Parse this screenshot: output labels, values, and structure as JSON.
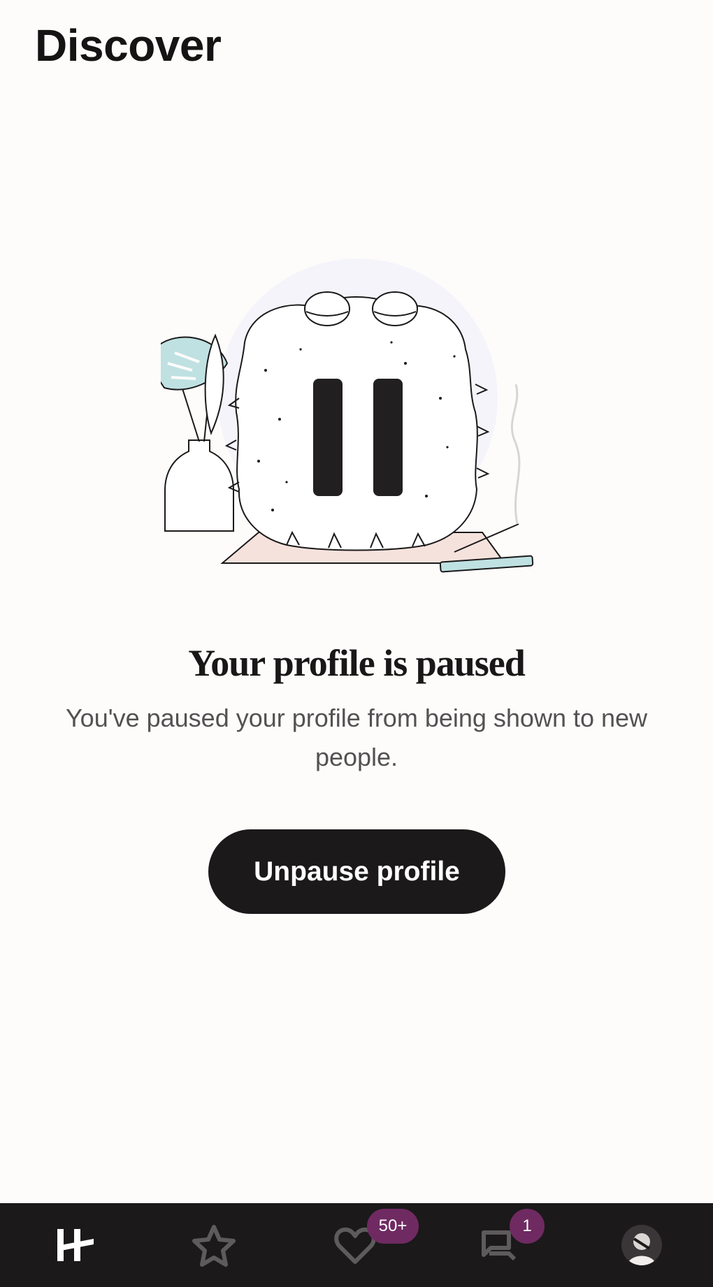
{
  "header": {
    "title": "Discover"
  },
  "paused": {
    "headline": "Your profile is paused",
    "message": "You've paused your profile from being shown to new people.",
    "button_label": "Unpause profile"
  },
  "bottom_nav": {
    "items": [
      {
        "id": "discover",
        "icon": "hinge-logo-icon",
        "active": true
      },
      {
        "id": "standouts",
        "icon": "star-icon",
        "active": false
      },
      {
        "id": "likes",
        "icon": "heart-icon",
        "active": false,
        "badge": "50+"
      },
      {
        "id": "matches",
        "icon": "chat-bubbles-icon",
        "active": false,
        "badge": "1"
      },
      {
        "id": "profile",
        "icon": "avatar",
        "active": false
      }
    ]
  },
  "colors": {
    "background": "#fdfcfb",
    "primary_button": "#1b191a",
    "nav_background": "#1b191a",
    "badge": "#6f2a62",
    "inactive_icon": "#5e5b5c"
  }
}
